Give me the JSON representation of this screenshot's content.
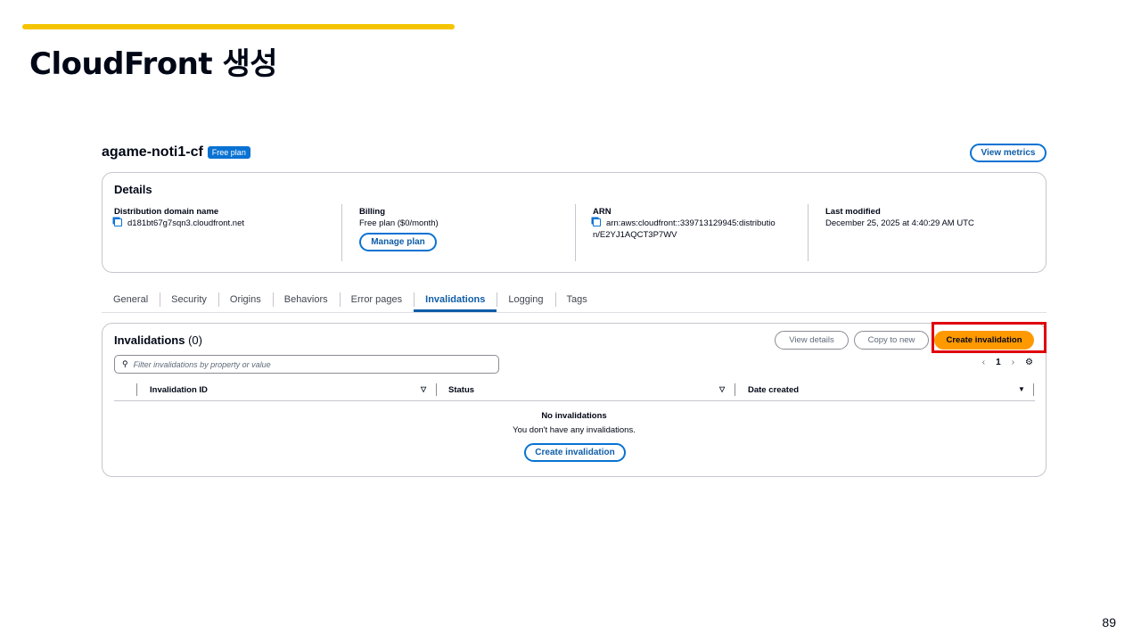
{
  "slide": {
    "title": "CloudFront 생성",
    "page_number": "89",
    "accent_color": "#f5c400"
  },
  "distribution": {
    "name": "agame-noti1-cf",
    "plan_badge": "Free plan",
    "view_metrics": "View metrics"
  },
  "details": {
    "heading": "Details",
    "domain_label": "Distribution domain name",
    "domain_value": "d181bt67g7sqn3.cloudfront.net",
    "billing_label": "Billing",
    "billing_value": "Free plan ($0/month)",
    "manage_plan": "Manage plan",
    "arn_label": "ARN",
    "arn_value_line1": "arn:aws:cloudfront::339713129945:distributio",
    "arn_value_line2": "n/E2YJ1AQCT3P7WV",
    "modified_label": "Last modified",
    "modified_value": "December 25, 2025 at 4:40:29 AM UTC"
  },
  "tabs": [
    {
      "label": "General"
    },
    {
      "label": "Security"
    },
    {
      "label": "Origins"
    },
    {
      "label": "Behaviors"
    },
    {
      "label": "Error pages"
    },
    {
      "label": "Invalidations",
      "active": true
    },
    {
      "label": "Logging"
    },
    {
      "label": "Tags"
    }
  ],
  "invalidations": {
    "heading": "Invalidations",
    "count": "(0)",
    "view_details": "View details",
    "copy_to_new": "Copy to new",
    "create": "Create invalidation",
    "search_placeholder": "Filter invalidations by property or value",
    "page": "1",
    "columns": [
      "Invalidation ID",
      "Status",
      "Date created"
    ],
    "empty_title": "No invalidations",
    "empty_text": "You don't have any invalidations.",
    "empty_button": "Create invalidation"
  }
}
